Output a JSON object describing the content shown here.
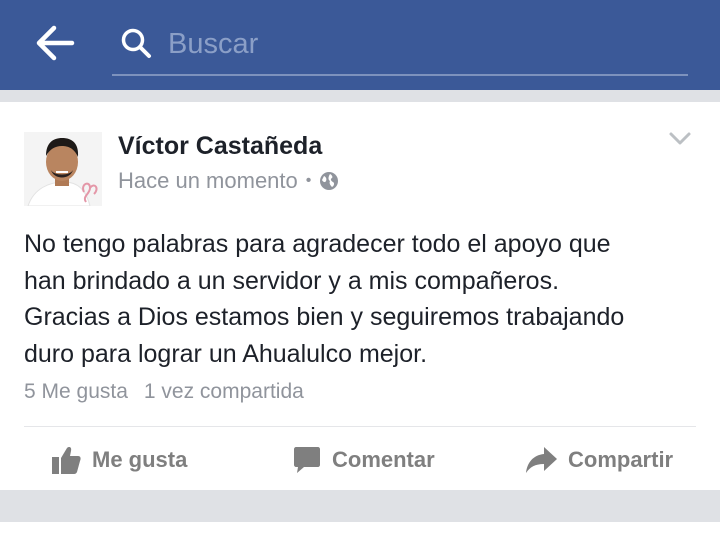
{
  "search": {
    "placeholder": "Buscar"
  },
  "post": {
    "author": "Víctor Castañeda",
    "time": "Hace un momento",
    "separator": "•",
    "text": "No tengo palabras para agradecer todo el apoyo que\nhan brindado a un servidor y a mis compañeros.\nGracias a Dios estamos bien y seguiremos trabajando\nduro para lograr un Ahualulco mejor.",
    "likes": "5 Me gusta",
    "shares": "1 vez compartida"
  },
  "actions": {
    "like": "Me gusta",
    "comment": "Comentar",
    "share": "Compartir"
  },
  "icons": {
    "back": "arrow-left-icon",
    "search": "search-icon",
    "globe": "globe-icon",
    "menu": "chevron-down-icon",
    "like": "thumbs-up-icon",
    "comment": "speech-bubble-icon",
    "share": "share-arrow-icon"
  },
  "colors": {
    "header": "#3b5998",
    "action_gray": "#7f7f7f",
    "meta_gray": "#90949c"
  }
}
